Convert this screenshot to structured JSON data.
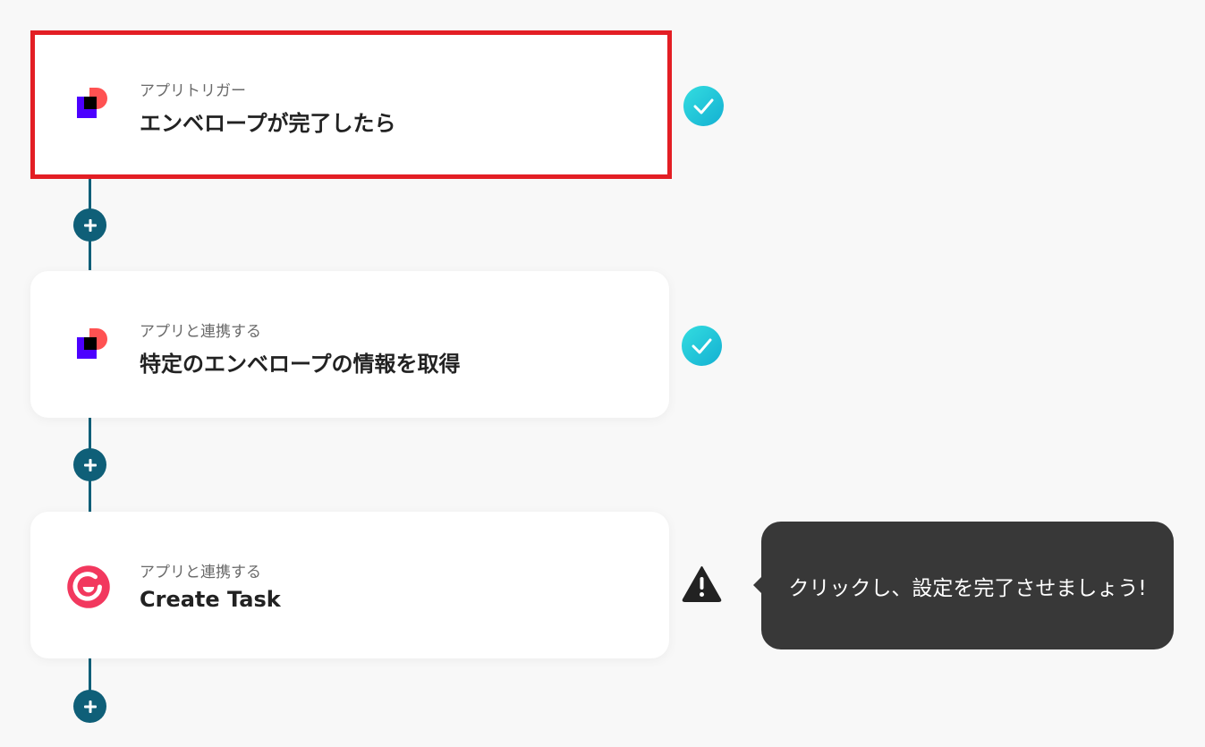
{
  "steps": [
    {
      "kind_label": "アプリトリガー",
      "title": "エンベロープが完了したら",
      "app_icon": "docusign-icon",
      "status": "completed"
    },
    {
      "kind_label": "アプリと連携する",
      "title": "特定のエンベロープの情報を取得",
      "app_icon": "docusign-icon",
      "status": "completed"
    },
    {
      "kind_label": "アプリと連携する",
      "title": "Create Task",
      "app_icon": "crm-c-logo-icon",
      "status": "warning"
    }
  ],
  "tooltip": {
    "message": "クリックし、設定を完了させましょう!"
  },
  "colors": {
    "connector": "#0f5f78",
    "selected_border": "#e31e24",
    "check_gradient_start": "#2bd4dc",
    "check_gradient_end": "#19b6d4",
    "warning": "#222222",
    "tooltip_bg": "#383838",
    "app2_accent": "#f2385e"
  }
}
